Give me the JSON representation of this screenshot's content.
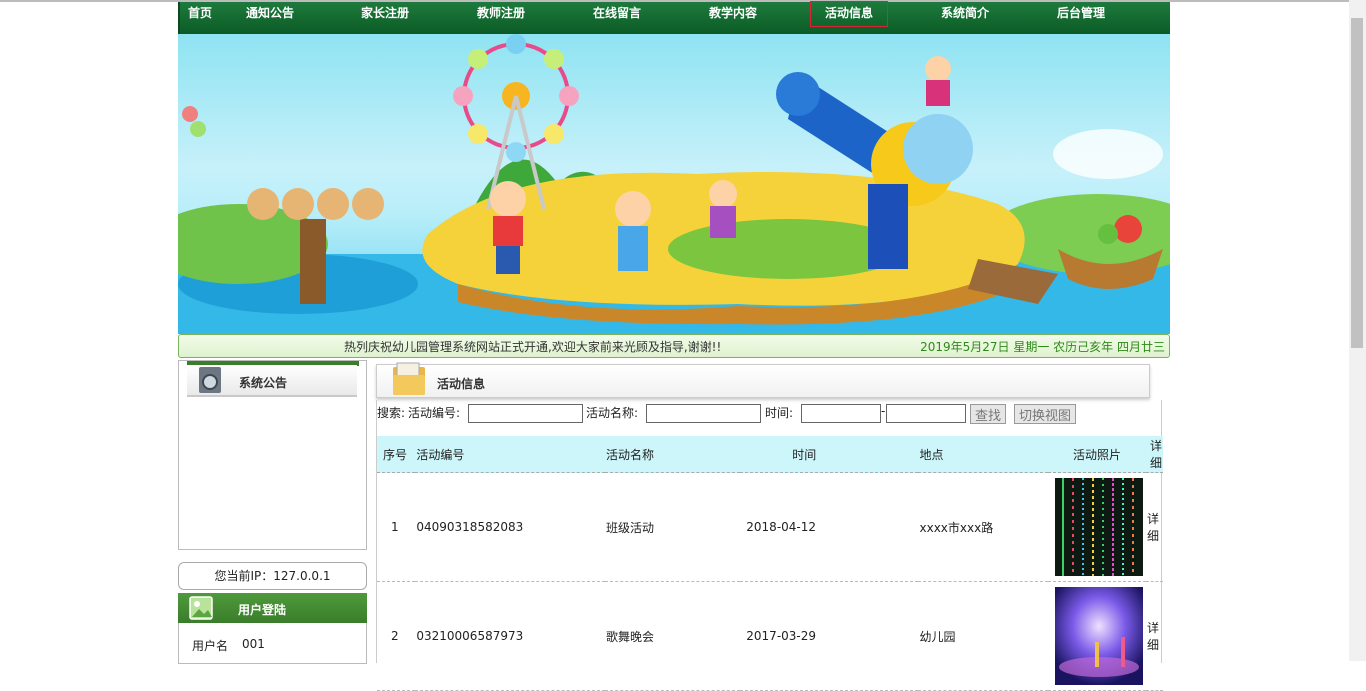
{
  "nav": {
    "items": [
      "首页",
      "通知公告",
      "家长注册",
      "教师注册",
      "在线留言",
      "教学内容",
      "活动信息",
      "系统简介",
      "后台管理"
    ],
    "active_index": 6
  },
  "marquee": {
    "text": "热列庆祝幼儿园管理系统网站正式开通,欢迎大家前来光顾及指导,谢谢!!",
    "date": "2019年5月27日 星期一 农历己亥年 四月廿三"
  },
  "sidebar": {
    "notice_title": "系统公告",
    "ip_text": "您当前IP：127.0.0.1",
    "login_title": "用户登陆",
    "username_label": "用户名",
    "username_value": "001"
  },
  "main": {
    "title": "活动信息",
    "search": {
      "label": "搜索:",
      "id_label": "活动编号:",
      "name_label": "活动名称:",
      "time_label": "时间:",
      "dash": "-",
      "find_button": "查找",
      "toggle_button": "切换视图"
    },
    "columns": [
      "序号",
      "活动编号",
      "活动名称",
      "时间",
      "地点",
      "活动照片",
      "详细"
    ],
    "rows": [
      {
        "no": "1",
        "code": "04090318582083",
        "name": "班级活动",
        "time": "2018-04-12",
        "place": "xxxx市xxx路",
        "detail": "详细"
      },
      {
        "no": "2",
        "code": "03210006587973",
        "name": "歌舞晚会",
        "time": "2017-03-29",
        "place": "幼儿园",
        "detail": "详细"
      }
    ]
  },
  "colors": {
    "nav_green": "#0b5b26",
    "header_cyan": "#ccf6fa",
    "date_green": "#2e8a18"
  }
}
